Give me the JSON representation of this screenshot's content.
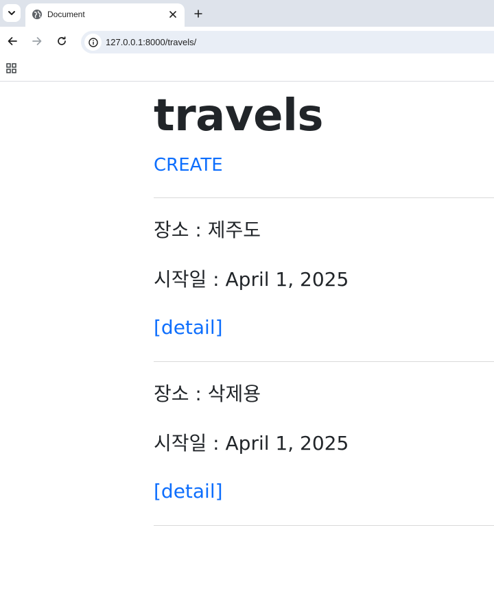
{
  "browser": {
    "tab_title": "Document",
    "url": "127.0.0.1:8000/travels/",
    "icons": {
      "tab_search": "chevron-down-icon",
      "favicon": "globe-icon",
      "tab_close": "close-icon",
      "new_tab": "plus-icon",
      "back": "arrow-left-icon",
      "forward": "arrow-right-icon",
      "reload": "reload-icon",
      "site_info": "info-icon",
      "apps": "apps-grid-icon"
    }
  },
  "page": {
    "title": "travels",
    "create_label": "CREATE",
    "link_color": "#0d6efd",
    "text_color": "#212529",
    "travels": [
      {
        "place_line": "장소 : 제주도",
        "start_line": "시작일 : April 1, 2025",
        "detail_label": "[detail]"
      },
      {
        "place_line": "장소 : 삭제용",
        "start_line": "시작일 : April 1, 2025",
        "detail_label": "[detail]"
      }
    ]
  }
}
